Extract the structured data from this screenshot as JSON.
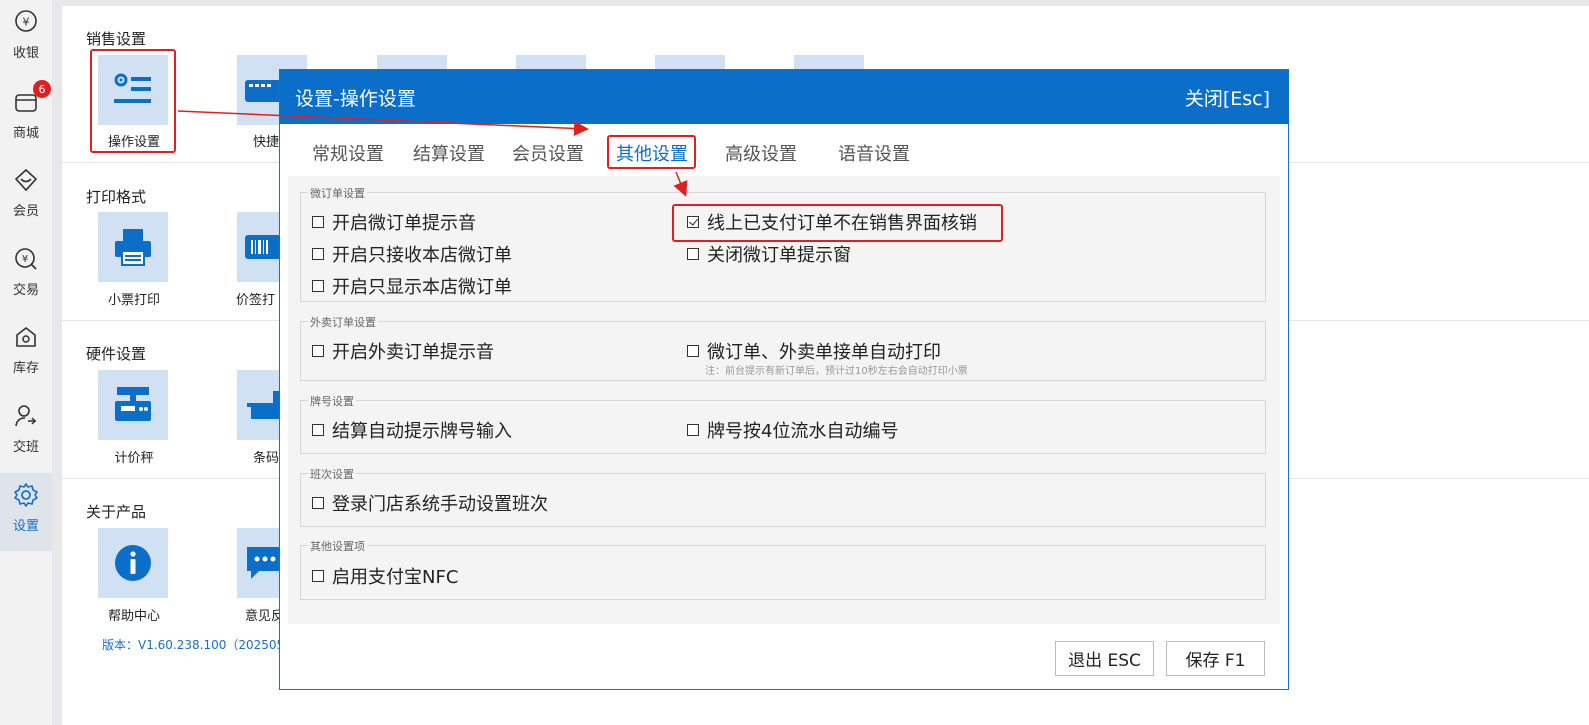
{
  "sidebar": {
    "items": [
      {
        "label": "收银",
        "icon": "cashier-icon"
      },
      {
        "label": "商城",
        "icon": "shop-icon"
      },
      {
        "label": "会员",
        "icon": "member-icon"
      },
      {
        "label": "交易",
        "icon": "trade-icon"
      },
      {
        "label": "库存",
        "icon": "inventory-icon"
      },
      {
        "label": "交班",
        "icon": "shift-icon"
      },
      {
        "label": "设置",
        "icon": "gear-icon"
      }
    ],
    "shop_badge": "6",
    "accent": "#1a6fc4"
  },
  "main": {
    "sections": [
      {
        "title": "销售设置",
        "tiles": [
          {
            "label": "操作设置",
            "icon": "settings-list-icon"
          },
          {
            "label": "快捷",
            "icon": "keyboard-icon"
          }
        ]
      },
      {
        "title": "打印格式",
        "tiles": [
          {
            "label": "小票打印",
            "icon": "printer-icon"
          },
          {
            "label": "价签打",
            "icon": "barcode-label-icon"
          }
        ]
      },
      {
        "title": "硬件设置",
        "tiles": [
          {
            "label": "计价秤",
            "icon": "scale-icon"
          },
          {
            "label": "条码",
            "icon": "barcode-scale-icon"
          }
        ]
      },
      {
        "title": "关于产品",
        "tiles": [
          {
            "label": "帮助中心",
            "icon": "info-icon"
          },
          {
            "label": "意见反",
            "icon": "feedback-icon"
          }
        ]
      }
    ],
    "version": "版本：V1.60.238.100（2025051",
    "highlight_color": "#e02020"
  },
  "modal": {
    "title": "设置-操作设置",
    "close_label": "关闭[Esc]",
    "header_color": "#0b6fc9",
    "tabs": [
      "常规设置",
      "结算设置",
      "会员设置",
      "其他设置",
      "高级设置",
      "语音设置"
    ],
    "active_tab": "其他设置",
    "groups": {
      "micro": {
        "title": "微订单设置",
        "opt1": "开启微订单提示音",
        "opt2": "线上已支付订单不在销售界面核销",
        "opt2_checked": true,
        "opt3": "开启只接收本店微订单",
        "opt4": "关闭微订单提示窗",
        "opt5": "开启只显示本店微订单"
      },
      "takeout": {
        "title": "外卖订单设置",
        "opt1": "开启外卖订单提示音",
        "opt2": "微订单、外卖单接单自动打印",
        "note": "注：前台提示有新订单后，预计过10秒左右会自动打印小票"
      },
      "tag": {
        "title": "牌号设置",
        "opt1": "结算自动提示牌号输入",
        "opt2": "牌号按4位流水自动编号"
      },
      "shift": {
        "title": "班次设置",
        "opt1": "登录门店系统手动设置班次"
      },
      "other": {
        "title": "其他设置项",
        "opt1": "启用支付宝NFC"
      }
    },
    "exit_button": "退出 ESC",
    "save_button": "保存 F1"
  }
}
